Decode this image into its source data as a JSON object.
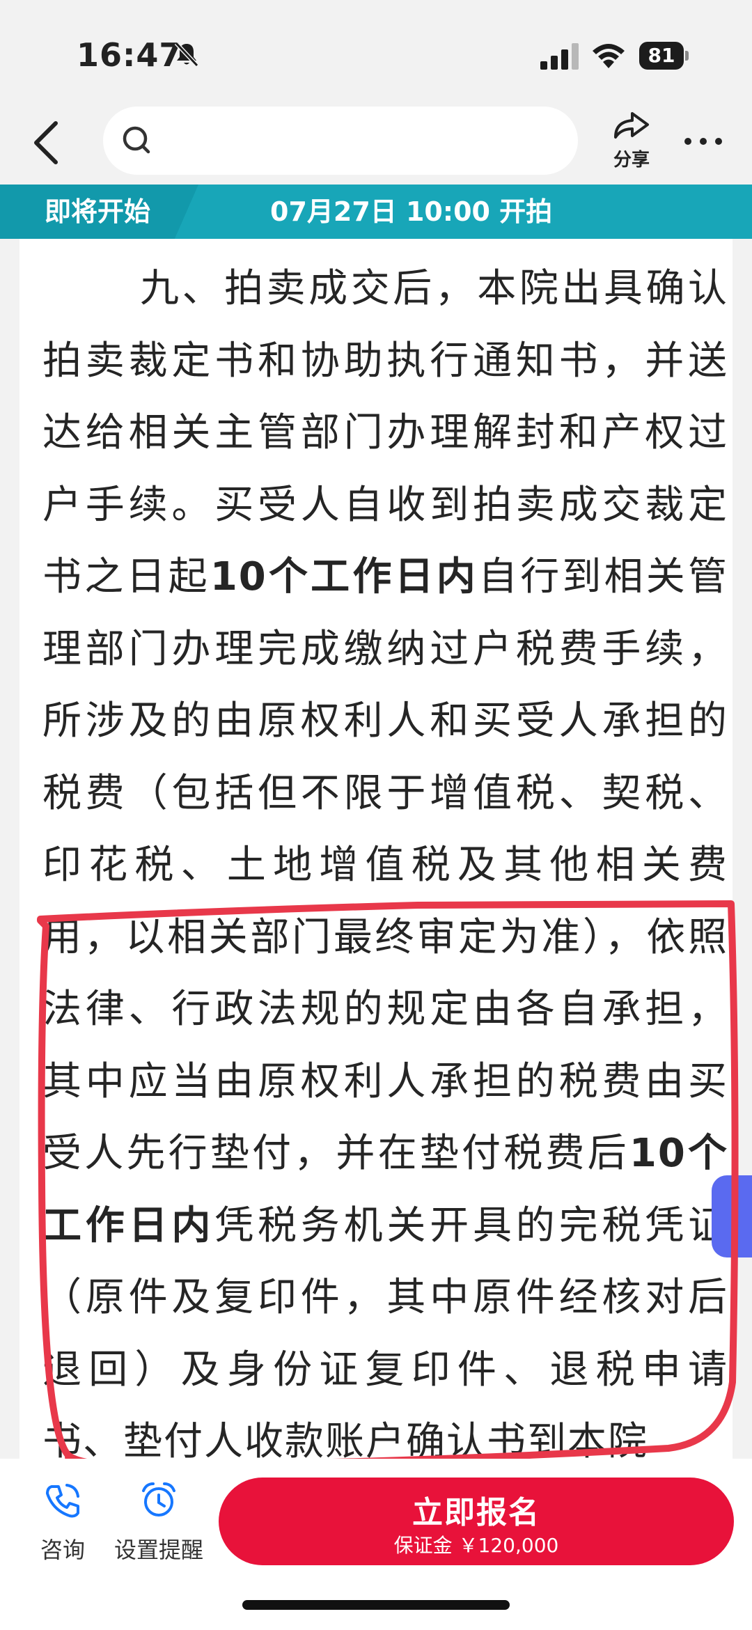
{
  "status_bar": {
    "time": "16:47",
    "battery": "81"
  },
  "nav": {
    "search_placeholder": "",
    "share_label": "分享"
  },
  "banner": {
    "status": "即将开始",
    "start_time": "07月27日 10:00 开拍"
  },
  "document": {
    "p1_part1": "九、拍卖成交后，本院出具确认拍卖裁定书和协助执行通知书，并送达给相关主管部门办理解封和产权过户手续。买受人自收到拍卖成交裁定书之日起",
    "p1_bold1": "10个工作日内",
    "p1_part2": "自行到相关管理部门办理完成缴纳过户税费手续，所涉及的由原权利人和买受人承担的税费（包括但不限于增值税、契税、印花税、土地增值税及其他相关费用，以相关部门最终审定为准），依照法律、行政法规的规定由各自承担，其中应当由原权利人承担的税费由买受人先行垫付，并在垫付税费后",
    "p1_bold2": "10个工作日内",
    "p1_part3": "凭税务机关开具的完税凭证（原件及复印件，其中原件经核对后退回）及身份证复印件、退税申请书、垫付人收款账户确认书到本院"
  },
  "bottom": {
    "consult_label": "咨询",
    "reminder_label": "设置提醒",
    "register_label": "立即报名",
    "deposit_label": "保证金 ￥120,000"
  },
  "colors": {
    "accent": "#e8123a",
    "banner": "#18a6b8",
    "annotation": "#e8384a"
  }
}
